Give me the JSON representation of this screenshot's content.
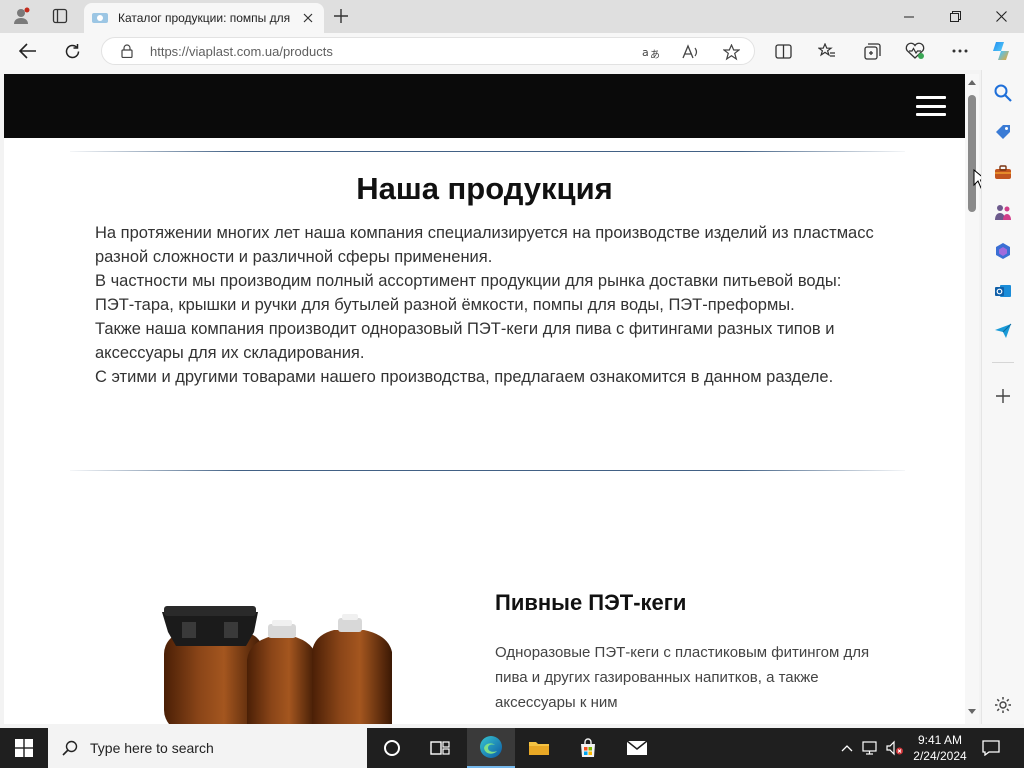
{
  "browser": {
    "tab": {
      "title": "Каталог продукции: помпы для",
      "favicon": "site-favicon"
    },
    "new_tab": "+",
    "address": {
      "url": "https://viaplast.com.ua/products"
    },
    "window_controls": [
      "minimize",
      "restore",
      "close"
    ]
  },
  "page": {
    "title": "Наша продукция",
    "intro": [
      "На протяжении многих лет наша компания специализируется на производстве изделий из пластмасс разной сложности и различной сферы применения.",
      "В частности мы производим полный ассортимент продукции для рынка доставки питьевой воды: ПЭТ-тара, крышки и ручки для бутылей разной ёмкости, помпы для воды, ПЭТ-преформы.",
      "Также наша компания производит одноразовый ПЭТ-кеги для пива с фитингами разных типов и аксессуары для их складирования.",
      "С этими и другими товарами нашего производства, предлагаем ознакомится в данном разделе."
    ],
    "product": {
      "title": "Пивные ПЭТ-кеги",
      "description": "Одноразовые ПЭТ-кеги с пластиковым фитингом для пива и других газированных напитков, а также аксессуары к ним"
    }
  },
  "taskbar": {
    "search_placeholder": "Type here to search",
    "time": "9:41 AM",
    "date": "2/24/2024"
  },
  "colors": {
    "header_bg": "#0a0a0a",
    "divider": "#2d5078",
    "keg_amber": "#7a3a12",
    "taskbar_bg": "#1f1f1f"
  }
}
